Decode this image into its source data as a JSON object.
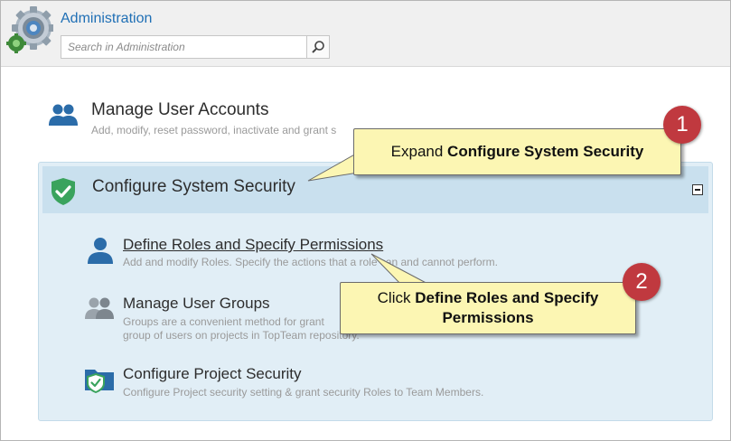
{
  "header": {
    "title": "Administration",
    "search_placeholder": "Search in Administration",
    "search_value": ""
  },
  "items": {
    "manage_users": {
      "title": "Manage User Accounts",
      "desc": "Add, modify, reset password, inactivate and grant s"
    },
    "configure_security": {
      "title": "Configure System Security",
      "sub": {
        "define_roles": {
          "title": "Define Roles and Specify Permissions",
          "desc": "Add and modify Roles. Specify the actions that a role can and cannot perform."
        },
        "user_groups": {
          "title": "Manage User Groups",
          "desc1": "Groups are a convenient method for grant",
          "desc2": "group of users on projects in TopTeam repository."
        },
        "project_security": {
          "title": "Configure Project Security",
          "desc": "Configure Project security setting & grant security Roles to Team Members."
        }
      }
    }
  },
  "callouts": {
    "one": {
      "badge": "1",
      "prefix": "Expand ",
      "bold": "Configure System Security"
    },
    "two": {
      "badge": "2",
      "prefix": "Click ",
      "bold1": "Define Roles and Specify",
      "bold2": "Permissions"
    }
  },
  "colors": {
    "accent_blue": "#1f6fb5",
    "icon_blue": "#2b6ca9",
    "shield_green": "#3aa35d",
    "callout_fill": "#fcf6b3",
    "badge_red": "#c0393f"
  }
}
